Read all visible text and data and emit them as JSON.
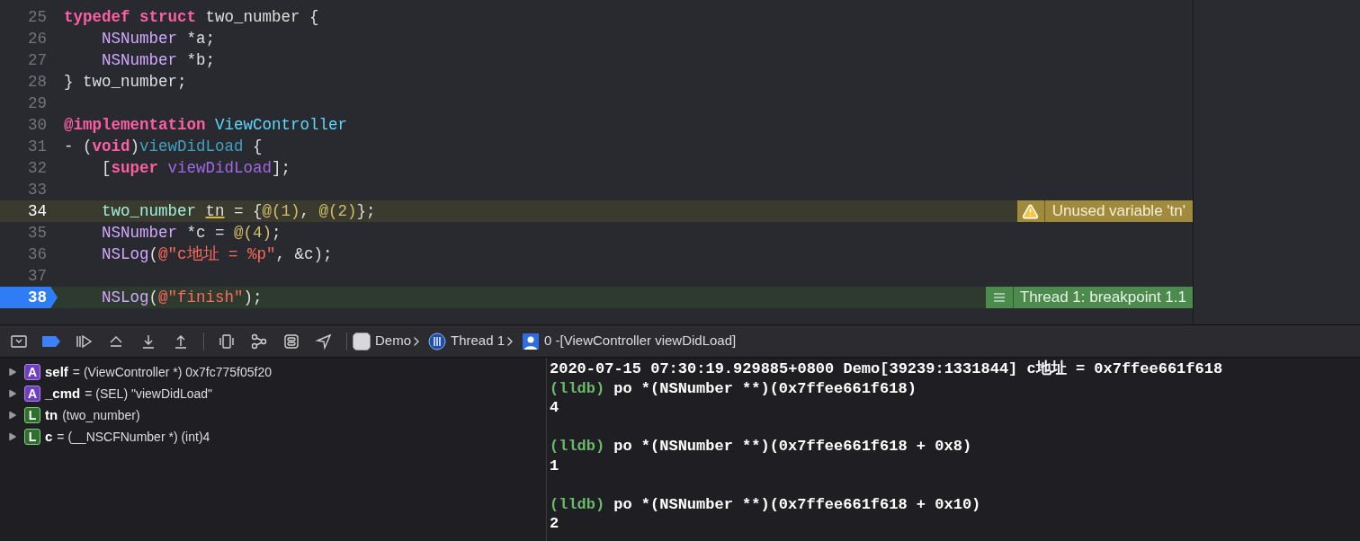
{
  "editor": {
    "lines": [
      {
        "number": "25",
        "kind": "normal",
        "segments": [
          {
            "text": "typedef ",
            "kind": "kw"
          },
          {
            "text": "struct",
            "kind": "kw"
          },
          {
            "text": " two_number {",
            "kind": "plain"
          }
        ]
      },
      {
        "number": "26",
        "kind": "normal",
        "segments": [
          {
            "text": "    NSNumber",
            "kind": "type"
          },
          {
            "text": " *a;",
            "kind": "plain"
          }
        ]
      },
      {
        "number": "27",
        "kind": "normal",
        "segments": [
          {
            "text": "    NSNumber",
            "kind": "type"
          },
          {
            "text": " *b;",
            "kind": "plain"
          }
        ]
      },
      {
        "number": "28",
        "kind": "normal",
        "segments": [
          {
            "text": "} two_number;",
            "kind": "plain"
          }
        ]
      },
      {
        "number": "29",
        "kind": "normal"
      },
      {
        "number": "30",
        "kind": "normal",
        "segments": [
          {
            "text": "@implementation ",
            "kind": "kw"
          },
          {
            "text": "ViewController",
            "kind": "class"
          }
        ]
      },
      {
        "number": "31",
        "kind": "normal",
        "segments": [
          {
            "text": "- (",
            "kind": "plain"
          },
          {
            "text": "void",
            "kind": "kw"
          },
          {
            "text": ")",
            "kind": "plain"
          },
          {
            "text": "viewDidLoad",
            "kind": "decl"
          },
          {
            "text": " {",
            "kind": "plain"
          }
        ]
      },
      {
        "number": "32",
        "kind": "normal",
        "segments": [
          {
            "text": "    [",
            "kind": "plain"
          },
          {
            "text": "super ",
            "kind": "kw"
          },
          {
            "text": "viewDidLoad",
            "kind": "method"
          },
          {
            "text": "];",
            "kind": "plain"
          }
        ]
      },
      {
        "number": "33",
        "kind": "normal"
      },
      {
        "number": "34",
        "kind": "warning",
        "annotation": "Unused variable 'tn'",
        "segments": [
          {
            "text": "    two_number ",
            "kind": "usertype"
          },
          {
            "text": "tn",
            "kind": "flagged"
          },
          {
            "text": " = {",
            "kind": "plain"
          },
          {
            "text": "@(1)",
            "kind": "num"
          },
          {
            "text": ", ",
            "kind": "plain"
          },
          {
            "text": "@(2)",
            "kind": "num"
          },
          {
            "text": "};",
            "kind": "plain"
          }
        ]
      },
      {
        "number": "35",
        "kind": "normal",
        "segments": [
          {
            "text": "    NSNumber",
            "kind": "type"
          },
          {
            "text": " *c = ",
            "kind": "plain"
          },
          {
            "text": "@(4)",
            "kind": "num"
          },
          {
            "text": ";",
            "kind": "plain"
          }
        ]
      },
      {
        "number": "36",
        "kind": "normal",
        "segments": [
          {
            "text": "    NSLog",
            "kind": "type"
          },
          {
            "text": "(",
            "kind": "plain"
          },
          {
            "text": "@\"c地址 = %p\"",
            "kind": "str"
          },
          {
            "text": ", &c);",
            "kind": "plain"
          }
        ]
      },
      {
        "number": "37",
        "kind": "normal"
      },
      {
        "number": "38",
        "kind": "current",
        "annotation": "Thread 1: breakpoint 1.1",
        "segments": [
          {
            "text": "    NSLog",
            "kind": "type"
          },
          {
            "text": "(",
            "kind": "plain"
          },
          {
            "text": "@\"finish\"",
            "kind": "str"
          },
          {
            "text": ");",
            "kind": "plain"
          }
        ]
      }
    ]
  },
  "debug_bar": {
    "breakpoints_active": true,
    "breadcrumb": [
      {
        "kind": "app",
        "label": "Demo"
      },
      {
        "kind": "thread",
        "label": "Thread 1"
      },
      {
        "kind": "frame",
        "label": "0 -[ViewController viewDidLoad]"
      }
    ]
  },
  "variables": [
    {
      "kind": "argument",
      "badge": "A",
      "name": "self",
      "detail": "= (ViewController *) 0x7fc775f05f20"
    },
    {
      "kind": "argument",
      "badge": "A",
      "name": "_cmd",
      "detail": "= (SEL) \"viewDidLoad\""
    },
    {
      "kind": "local",
      "badge": "L",
      "name": "tn",
      "detail": "(two_number)"
    },
    {
      "kind": "local",
      "badge": "L",
      "name": "c",
      "detail": "= (__NSCFNumber *) (int)4"
    }
  ],
  "console": [
    {
      "kind": "output",
      "text": "2020-07-15 07:30:19.929885+0800 Demo[39239:1331844] c地址 = 0x7ffee661f618"
    },
    {
      "kind": "command",
      "prompt": "(lldb)",
      "text": "po *(NSNumber **)(0x7ffee661f618)"
    },
    {
      "kind": "output",
      "text": "4"
    },
    {
      "kind": "command",
      "prompt": "(lldb)",
      "text": "po *(NSNumber **)(0x7ffee661f618 + 0x8)"
    },
    {
      "kind": "output",
      "text": "1"
    },
    {
      "kind": "command",
      "prompt": "(lldb)",
      "text": "po *(NSNumber **)(0x7ffee661f618 + 0x10)"
    },
    {
      "kind": "output",
      "text": "2"
    }
  ]
}
